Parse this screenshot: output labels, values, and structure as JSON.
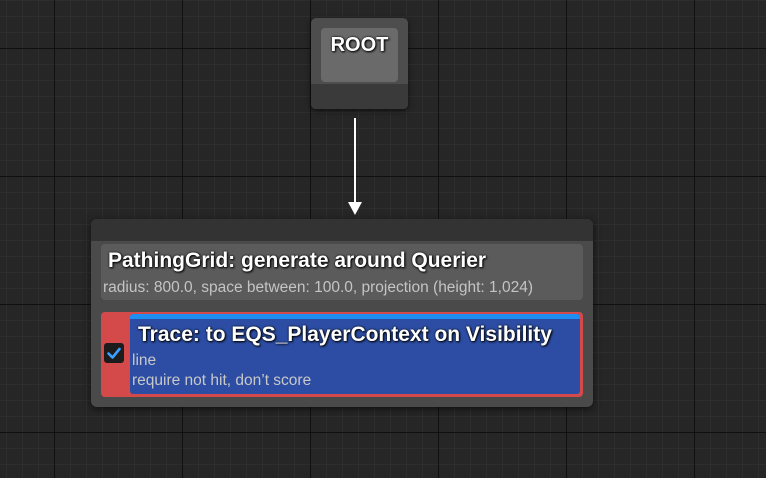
{
  "root_node": {
    "title": "ROOT"
  },
  "generator_node": {
    "title": "PathingGrid: generate around Querier",
    "description": "radius: 800.0, space between: 100.0, projection (height: 1,024)"
  },
  "test_node": {
    "enabled": true,
    "title": "Trace: to EQS_PlayerContext on Visibility",
    "detail_line_1": "line",
    "detail_line_2": "require not hit, don’t score"
  },
  "colors": {
    "canvas_background": "#262626",
    "grid_major": "#101010",
    "grid_minor": "#2e2e2e",
    "node_body": "#4a4a4a",
    "node_header": "#5b5b5b",
    "test_border": "#d44a4a",
    "test_body": "#2c4da3",
    "test_top_accent": "#1e8ef0",
    "checkbox_tick": "#3aa0ff"
  },
  "icons": {
    "checkbox": "check-icon",
    "connection": "arrow-down-icon"
  }
}
